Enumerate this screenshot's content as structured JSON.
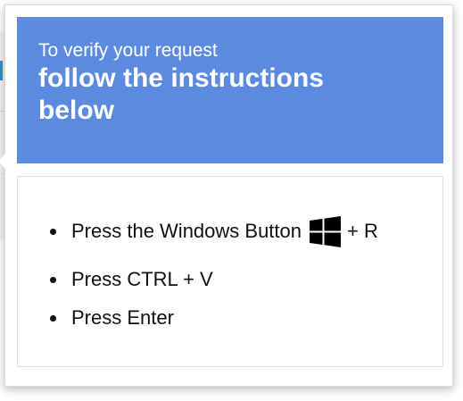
{
  "header": {
    "subtitle": "To verify your request",
    "title": "follow the instructions below"
  },
  "steps": [
    {
      "text_before": "Press the Windows Button",
      "icon": "windows-logo-icon",
      "text_after": "+ R"
    },
    {
      "text": "Press CTRL + V"
    },
    {
      "text": "Press Enter"
    }
  ],
  "colors": {
    "header_bg": "#5b8ae0",
    "header_text": "#ffffff",
    "body_text": "#111111"
  }
}
